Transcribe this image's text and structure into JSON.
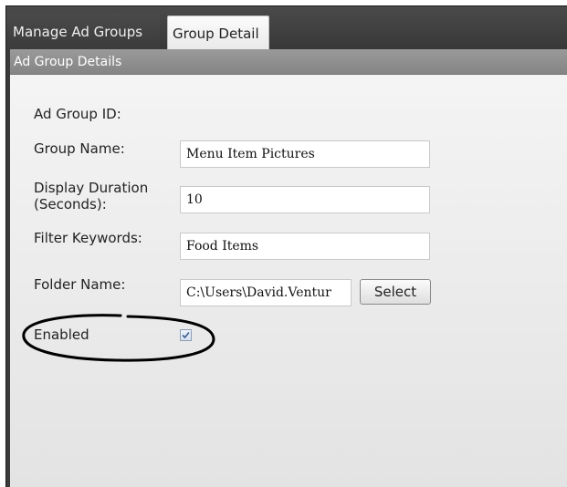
{
  "tabs": [
    {
      "label": "Manage Ad Groups",
      "active": false
    },
    {
      "label": "Group Detail",
      "active": true
    }
  ],
  "panel": {
    "header": "Ad Group Details"
  },
  "form": {
    "ad_group_id_label": "Ad Group ID:",
    "group_name_label": "Group Name:",
    "group_name_value": "Menu Item Pictures",
    "display_duration_label_line1": "Display Duration",
    "display_duration_label_line2": "(Seconds):",
    "display_duration_value": "10",
    "filter_keywords_label": "Filter Keywords:",
    "filter_keywords_value": "Food Items",
    "folder_name_label": "Folder Name:",
    "folder_name_value": "C:\\Users\\David.Ventur",
    "select_button": "Select",
    "enabled_label": "Enabled",
    "enabled_checked": true
  },
  "colors": {
    "tabbar": "#3a3a3a",
    "panel_header": "#8f8f8f",
    "content_bg": "#f0f0f0",
    "annotation": "#000000"
  }
}
